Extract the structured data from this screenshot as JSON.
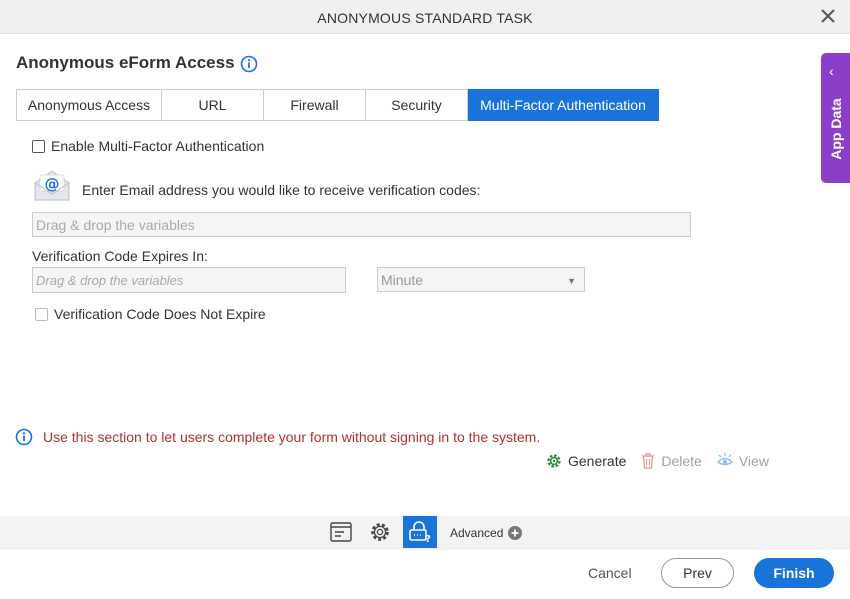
{
  "dialog": {
    "title": "ANONYMOUS STANDARD TASK"
  },
  "heading": "Anonymous eForm Access",
  "tabs": [
    {
      "label": "Anonymous Access"
    },
    {
      "label": "URL"
    },
    {
      "label": "Firewall"
    },
    {
      "label": "Security"
    },
    {
      "label": "Multi-Factor Authentication"
    }
  ],
  "mfa": {
    "enable_label": "Enable Multi-Factor Authentication",
    "enable_checked": false,
    "email_label": "Enter Email address you would like to receive verification codes:",
    "email_placeholder": "Drag & drop the variables",
    "expires_label": "Verification Code Expires In:",
    "expires_placeholder": "Drag & drop the variables",
    "unit_selected": "Minute",
    "no_expire_label": "Verification Code Does Not Expire",
    "no_expire_checked": false
  },
  "info": {
    "message": "Use this section to let users complete your form without signing in to the system."
  },
  "actions": {
    "generate": "Generate",
    "delete": "Delete",
    "view": "View"
  },
  "side_panel": {
    "label": "App Data"
  },
  "toolbar": {
    "advanced": "Advanced"
  },
  "footer": {
    "cancel": "Cancel",
    "prev": "Prev",
    "finish": "Finish"
  },
  "colors": {
    "accent": "#1a73d9",
    "side_panel": "#8b3fc9",
    "info_text": "#b03030",
    "generate_icon": "#2e8b3e"
  },
  "icons": [
    "close-icon",
    "info-icon",
    "email-icon",
    "gear-icon",
    "trash-icon",
    "view-icon",
    "form-icon",
    "settings-icon",
    "lock-question-icon",
    "plus-circle-icon",
    "chevron-left-icon"
  ]
}
